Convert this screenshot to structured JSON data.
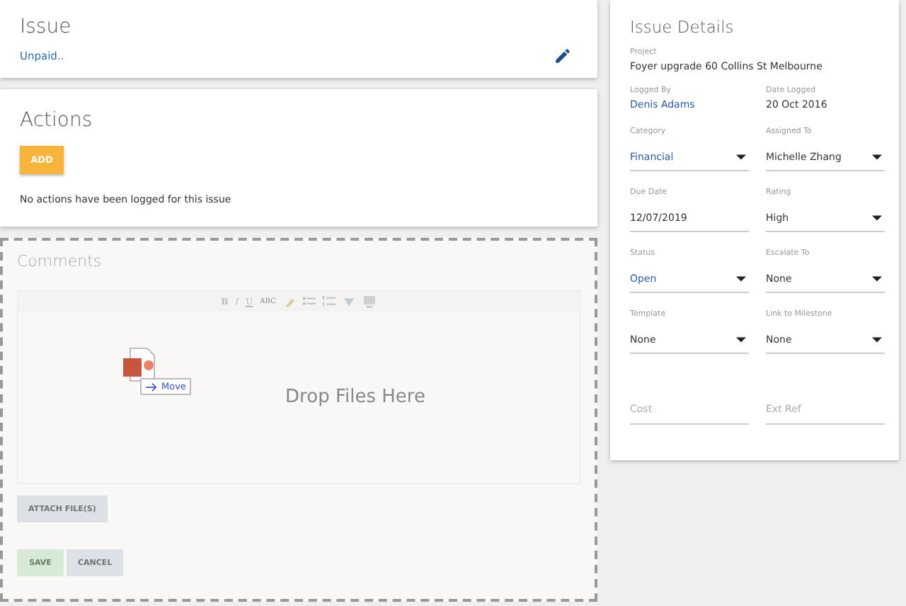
{
  "issue": {
    "title": "Issue",
    "summary": "Unpaid.."
  },
  "actions": {
    "title": "Actions",
    "add_button": "ADD",
    "empty_message": "No actions have been logged for this issue"
  },
  "comments": {
    "title": "Comments",
    "toolbar": [
      "B",
      "I",
      "U",
      "ABC"
    ],
    "drop_hint": "Drop Files Here",
    "drag_label": "Move",
    "attach_button": "ATTACH FILE(S)",
    "save_button": "SAVE",
    "cancel_button": "CANCEL"
  },
  "details": {
    "title": "Issue Details",
    "project_label": "Project",
    "project": "Foyer upgrade 60 Collins St Melbourne",
    "fields": [
      {
        "kind": "static",
        "label": "Logged By",
        "value": "Denis Adams",
        "highlighted": true
      },
      {
        "kind": "static",
        "label": "Date Logged",
        "value": "20 Oct 2016",
        "highlighted": false
      },
      {
        "kind": "select",
        "label": "Category",
        "value": "Financial",
        "highlighted": true
      },
      {
        "kind": "select",
        "label": "Assigned To",
        "value": "Michelle Zhang",
        "highlighted": false
      },
      {
        "kind": "input",
        "label": "Due Date",
        "value": "12/07/2019",
        "highlighted": false
      },
      {
        "kind": "select",
        "label": "Rating",
        "value": "High",
        "highlighted": false
      },
      {
        "kind": "select",
        "label": "Status",
        "value": "Open",
        "highlighted": true
      },
      {
        "kind": "select",
        "label": "Escalate To",
        "value": "None",
        "highlighted": false
      },
      {
        "kind": "select",
        "label": "Template",
        "value": "None",
        "highlighted": false
      },
      {
        "kind": "select",
        "label": "Link to Milestone",
        "value": "None",
        "highlighted": false
      },
      {
        "kind": "empty",
        "placeholder": "Cost"
      },
      {
        "kind": "empty",
        "placeholder": "Ext Ref"
      }
    ]
  }
}
